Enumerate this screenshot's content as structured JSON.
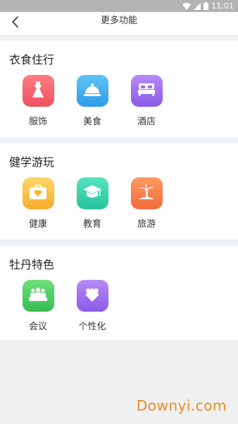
{
  "status_bar": {
    "time": "11:01"
  },
  "nav": {
    "title": "更多功能"
  },
  "sections": [
    {
      "title": "衣食住行",
      "items": [
        {
          "label": "服饰",
          "icon": "dress-icon",
          "color_top": "#ff7e84",
          "color_bottom": "#ee4f5d"
        },
        {
          "label": "美食",
          "icon": "food-cloche-icon",
          "color_top": "#5fc4f6",
          "color_bottom": "#2f9be8"
        },
        {
          "label": "酒店",
          "icon": "bed-icon",
          "color_top": "#b88af7",
          "color_bottom": "#8b5ae6"
        }
      ]
    },
    {
      "title": "健学游玩",
      "items": [
        {
          "label": "健康",
          "icon": "medical-kit-icon",
          "color_top": "#ffd56a",
          "color_bottom": "#f7ae2a"
        },
        {
          "label": "教育",
          "icon": "graduation-cap-icon",
          "color_top": "#58e3c0",
          "color_bottom": "#25c39b"
        },
        {
          "label": "旅游",
          "icon": "palm-tree-icon",
          "color_top": "#ff9a64",
          "color_bottom": "#f26a3a"
        }
      ]
    },
    {
      "title": "牡丹特色",
      "items": [
        {
          "label": "会议",
          "icon": "meeting-people-icon",
          "color_top": "#6ee07c",
          "color_bottom": "#36bd52"
        },
        {
          "label": "个性化",
          "icon": "puzzle-icon",
          "color_top": "#b88af7",
          "color_bottom": "#8b5ae6"
        }
      ]
    }
  ],
  "watermark": "Downyi.com"
}
